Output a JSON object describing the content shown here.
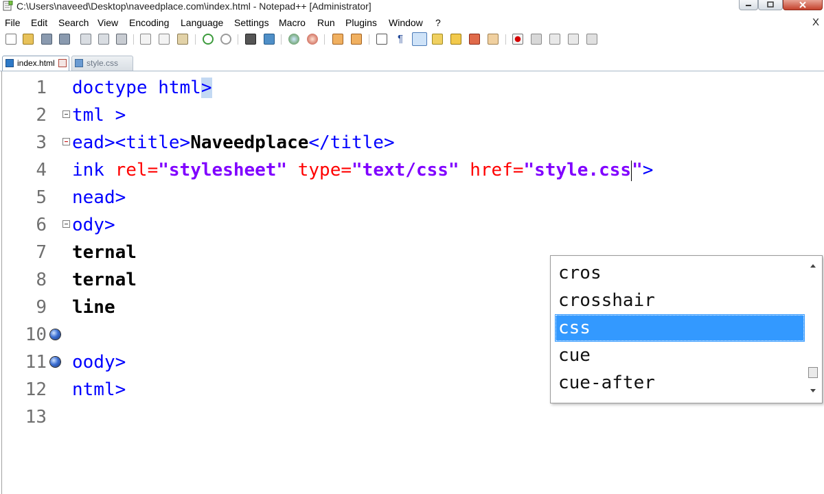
{
  "window": {
    "title": "C:\\Users\\naveed\\Desktop\\naveedplace.com\\index.html - Notepad++ [Administrator]",
    "close_x": "X"
  },
  "menu": [
    "File",
    "Edit",
    "Search",
    "View",
    "Encoding",
    "Language",
    "Settings",
    "Macro",
    "Run",
    "Plugins",
    "Window",
    "?"
  ],
  "tabs": [
    {
      "label": "index.html",
      "active": true
    },
    {
      "label": "style.css",
      "active": false
    }
  ],
  "editor": {
    "line_numbers": [
      "1",
      "2",
      "3",
      "4",
      "5",
      "6",
      "7",
      "8",
      "9",
      "10",
      "11",
      "12",
      "13"
    ],
    "lines": [
      [
        {
          "t": "doctype html",
          "c": "t-tag"
        },
        {
          "t": ">",
          "c": "t-tag t-hl"
        }
      ],
      [
        {
          "t": "tml >",
          "c": "t-tag"
        }
      ],
      [
        {
          "t": "ead><title>",
          "c": "t-tag"
        },
        {
          "t": "Naveedplace",
          "c": "t-txt"
        },
        {
          "t": "</title>",
          "c": "t-tag"
        }
      ],
      [
        {
          "t": "ink ",
          "c": "t-tag"
        },
        {
          "t": "rel=",
          "c": "t-attr"
        },
        {
          "t": "\"stylesheet\"",
          "c": "t-str"
        },
        {
          "t": " ",
          "c": "t-tag"
        },
        {
          "t": "type=",
          "c": "t-attr"
        },
        {
          "t": "\"text/css\"",
          "c": "t-str"
        },
        {
          "t": " ",
          "c": "t-tag"
        },
        {
          "t": "href=",
          "c": "t-attr"
        },
        {
          "t": "\"style.css",
          "c": "t-str"
        },
        {
          "t": "caret",
          "c": "caret"
        },
        {
          "t": "\"",
          "c": "t-str"
        },
        {
          "t": ">",
          "c": "t-tag"
        }
      ],
      [
        {
          "t": "nead>",
          "c": "t-tag"
        }
      ],
      [
        {
          "t": "ody>",
          "c": "t-tag"
        }
      ],
      [
        {
          "t": "ternal",
          "c": "t-txt"
        }
      ],
      [
        {
          "t": "ternal",
          "c": "t-txt"
        }
      ],
      [
        {
          "t": "line",
          "c": "t-txt"
        }
      ],
      [],
      [
        {
          "t": "oody>",
          "c": "t-tag"
        }
      ],
      [
        {
          "t": "ntml>",
          "c": "t-tag"
        }
      ],
      []
    ]
  },
  "autocomplete": {
    "items": [
      "cros",
      "crosshair",
      "css",
      "cue",
      "cue-after"
    ],
    "selected": "css"
  }
}
